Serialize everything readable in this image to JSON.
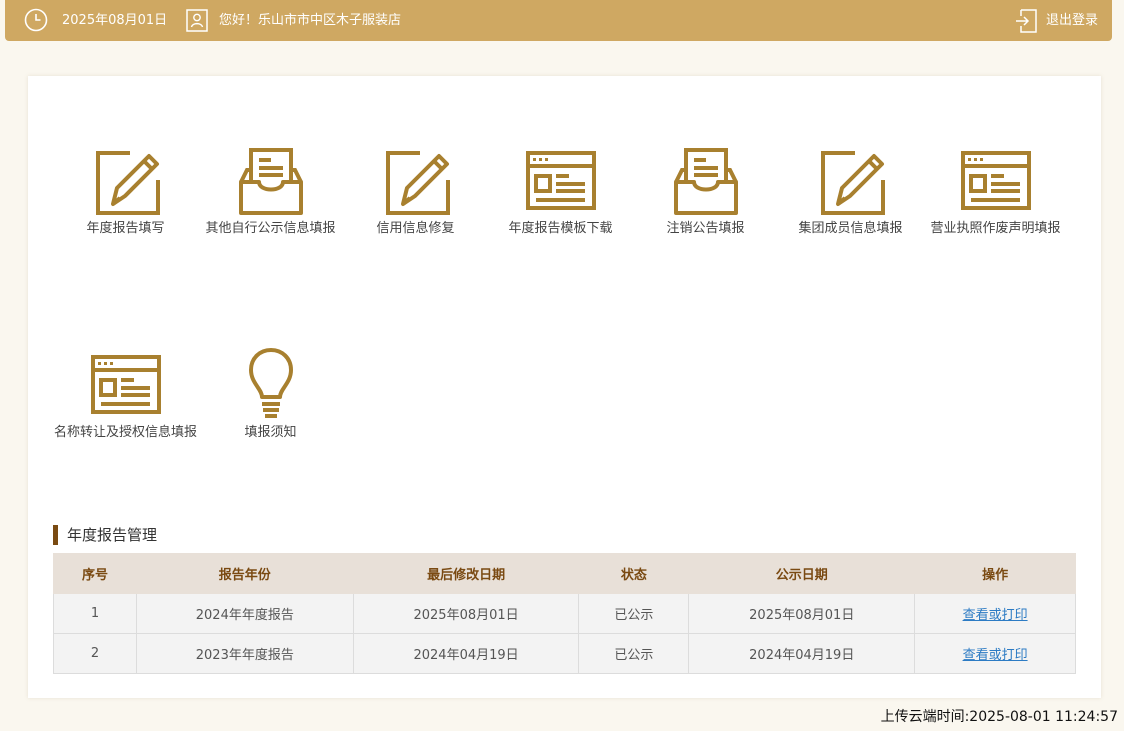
{
  "header": {
    "date": "2025年08月01日",
    "greeting": "您好！乐山市市中区木子服装店",
    "logout_label": "退出登录"
  },
  "colors": {
    "accent": "#cfa862",
    "icon": "#a8802f",
    "section_marker": "#7a4a12",
    "link": "#2c7bc4"
  },
  "tiles": [
    {
      "label": "年度报告填写",
      "icon": "edit-pencil-icon"
    },
    {
      "label": "其他自行公示信息填报",
      "icon": "inbox-tray-icon"
    },
    {
      "label": "信用信息修复",
      "icon": "edit-pencil-icon"
    },
    {
      "label": "年度报告模板下载",
      "icon": "form-window-icon"
    },
    {
      "label": "注销公告填报",
      "icon": "inbox-tray-icon"
    },
    {
      "label": "集团成员信息填报",
      "icon": "edit-pencil-icon"
    },
    {
      "label": "营业执照作废声明填报",
      "icon": "form-window-icon"
    },
    {
      "label": "名称转让及授权信息填报",
      "icon": "form-window-icon"
    },
    {
      "label": "填报须知",
      "icon": "lightbulb-icon"
    }
  ],
  "annual_report": {
    "title": "年度报告管理",
    "columns": [
      "序号",
      "报告年份",
      "最后修改日期",
      "状态",
      "公示日期",
      "操作"
    ],
    "rows": [
      [
        "1",
        "2024年年度报告",
        "2025年08月01日",
        "已公示",
        "2025年08月01日",
        "查看或打印"
      ],
      [
        "2",
        "2023年年度报告",
        "2024年04月19日",
        "已公示",
        "2024年04月19日",
        "查看或打印"
      ]
    ]
  },
  "upload_time": "上传云端时间:2025-08-01 11:24:57"
}
